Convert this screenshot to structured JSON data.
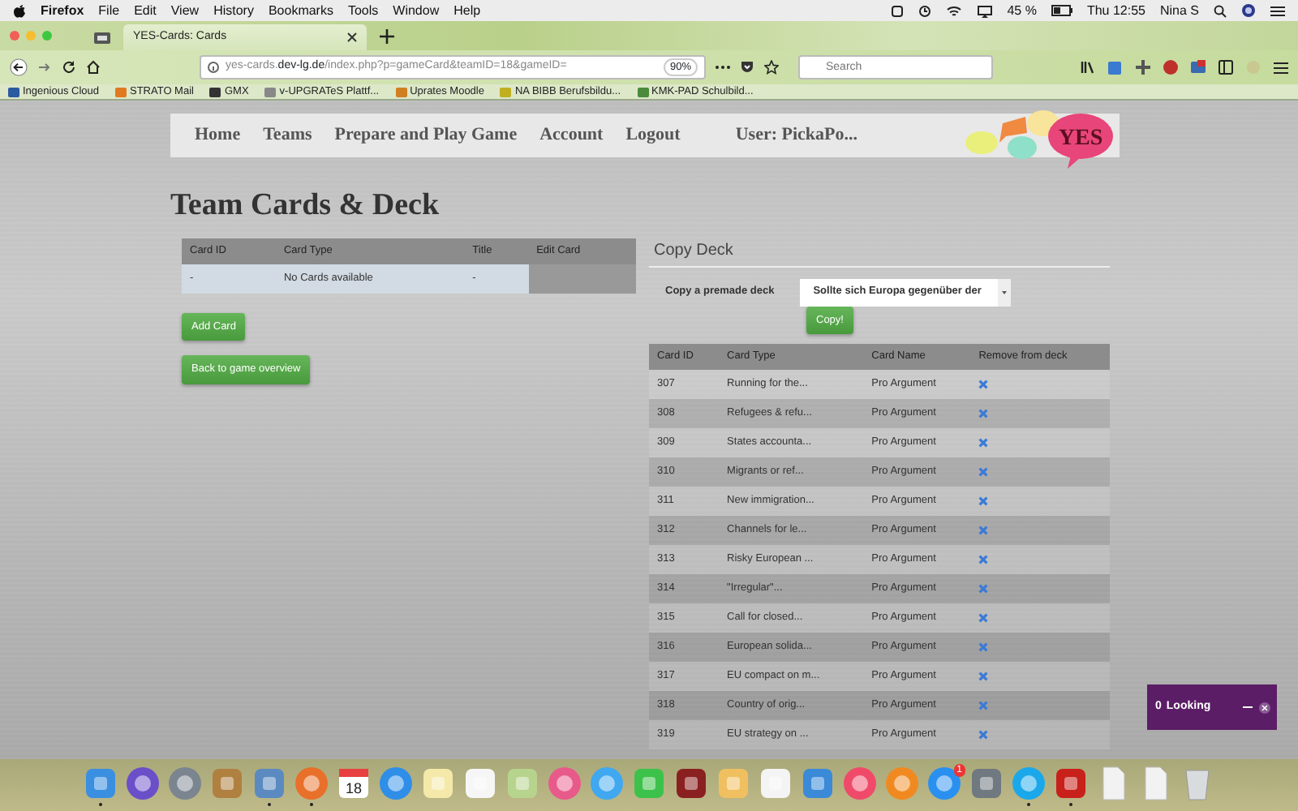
{
  "menubar": {
    "app": "Firefox",
    "menus": [
      "File",
      "Edit",
      "View",
      "History",
      "Bookmarks",
      "Tools",
      "Window",
      "Help"
    ],
    "battery": "45 %",
    "clock": "Thu 12:55",
    "user": "Nina S"
  },
  "tabs": [
    {
      "selected": false
    },
    {
      "title": "YES-Cards: Cards",
      "selected": true
    }
  ],
  "address": {
    "host": "yes-cards.",
    "domain": "dev-lg.de",
    "path": "/index.php?p=gameCard&teamID=18&gameID=",
    "zoom": "90%"
  },
  "search": {
    "placeholder": "Search"
  },
  "bookmarks": [
    "Ingenious Cloud",
    "STRATO Mail",
    "GMX",
    "v-UPGRATeS Plattf...",
    "Uprates Moodle",
    "NA BIBB Berufsbildu...",
    "KMK-PAD Schulbild..."
  ],
  "nav": {
    "items": [
      "Home",
      "Teams",
      "Prepare and Play Game",
      "Account",
      "Logout"
    ],
    "user": "User: PickaPo...",
    "logo": "YES"
  },
  "page_title": "Team Cards & Deck",
  "team_cards": {
    "columns": [
      "Card ID",
      "Card Type",
      "Title",
      "Edit Card"
    ],
    "rows": [
      [
        "-",
        "No Cards available",
        "-"
      ]
    ],
    "buttons": [
      "Add Card",
      "Back to game overview"
    ]
  },
  "copy_deck": {
    "heading": "Copy Deck",
    "label": "Copy a premade deck",
    "value": "Sollte sich Europa gegenüber der",
    "button": "Copy!"
  },
  "deck": {
    "columns": [
      "Card ID",
      "Card Type",
      "Card Name",
      "Remove from deck"
    ],
    "rows": [
      [
        "307",
        "Running for the...",
        "Pro Argument"
      ],
      [
        "308",
        "Refugees & refu...",
        "Pro Argument"
      ],
      [
        "309",
        "States accounta...",
        "Pro Argument"
      ],
      [
        "310",
        "Migrants or ref...",
        "Pro Argument"
      ],
      [
        "311",
        "New immigration...",
        "Pro Argument"
      ],
      [
        "312",
        "Channels for le...",
        "Pro Argument"
      ],
      [
        "313",
        "Risky European ...",
        "Pro Argument"
      ],
      [
        "314",
        "\"Irregular\"...",
        "Pro Argument"
      ],
      [
        "315",
        "Call for closed...",
        "Pro Argument"
      ],
      [
        "316",
        "European solida...",
        "Pro Argument"
      ],
      [
        "317",
        "EU compact on m...",
        "Pro Argument"
      ],
      [
        "318",
        "Country of orig...",
        "Pro Argument"
      ],
      [
        "319",
        "EU strategy on ...",
        "Pro Argument"
      ]
    ]
  },
  "chat": {
    "count": "0",
    "label": "Looking"
  },
  "dock": [
    {
      "kind": "app",
      "color": "#3b8fe0",
      "running": true
    },
    {
      "kind": "round",
      "color": "#6a4fc9",
      "running": false
    },
    {
      "kind": "round",
      "color": "#7b8590",
      "running": false
    },
    {
      "kind": "app",
      "color": "#b08040",
      "running": false
    },
    {
      "kind": "app",
      "color": "#5a8ac0",
      "running": true
    },
    {
      "kind": "round",
      "color": "#e8702a",
      "running": true
    },
    {
      "kind": "calendar",
      "color": "#ffffff",
      "date": "18",
      "running": false
    },
    {
      "kind": "round",
      "color": "#2f8ee8",
      "running": false
    },
    {
      "kind": "app",
      "color": "#f4e9a8",
      "running": false
    },
    {
      "kind": "app",
      "color": "#f6f6f6",
      "running": false
    },
    {
      "kind": "app",
      "color": "#b7d48c",
      "running": false
    },
    {
      "kind": "round",
      "color": "#e85a8a",
      "running": false
    },
    {
      "kind": "round",
      "color": "#3fa8f0",
      "running": false
    },
    {
      "kind": "app",
      "color": "#3cc24a",
      "running": false
    },
    {
      "kind": "app",
      "color": "#8a2020",
      "running": false
    },
    {
      "kind": "app",
      "color": "#f0c060",
      "running": false
    },
    {
      "kind": "app",
      "color": "#f4f4f4",
      "running": false
    },
    {
      "kind": "app",
      "color": "#3a8ad8",
      "running": false
    },
    {
      "kind": "round",
      "color": "#f04a6a",
      "running": false
    },
    {
      "kind": "round",
      "color": "#f08a20",
      "running": false
    },
    {
      "kind": "round",
      "color": "#2a90f0",
      "badge": "1",
      "running": false
    },
    {
      "kind": "app",
      "color": "#707880",
      "running": false
    },
    {
      "kind": "round",
      "color": "#1aa8ea",
      "running": true
    },
    {
      "kind": "app",
      "color": "#c8201a",
      "running": true
    },
    {
      "kind": "document",
      "color": "#f2f2f2",
      "running": false
    },
    {
      "kind": "document",
      "color": "#f2f2f2",
      "running": false
    },
    {
      "kind": "trash",
      "color": "#d8dcdf",
      "running": false
    }
  ]
}
